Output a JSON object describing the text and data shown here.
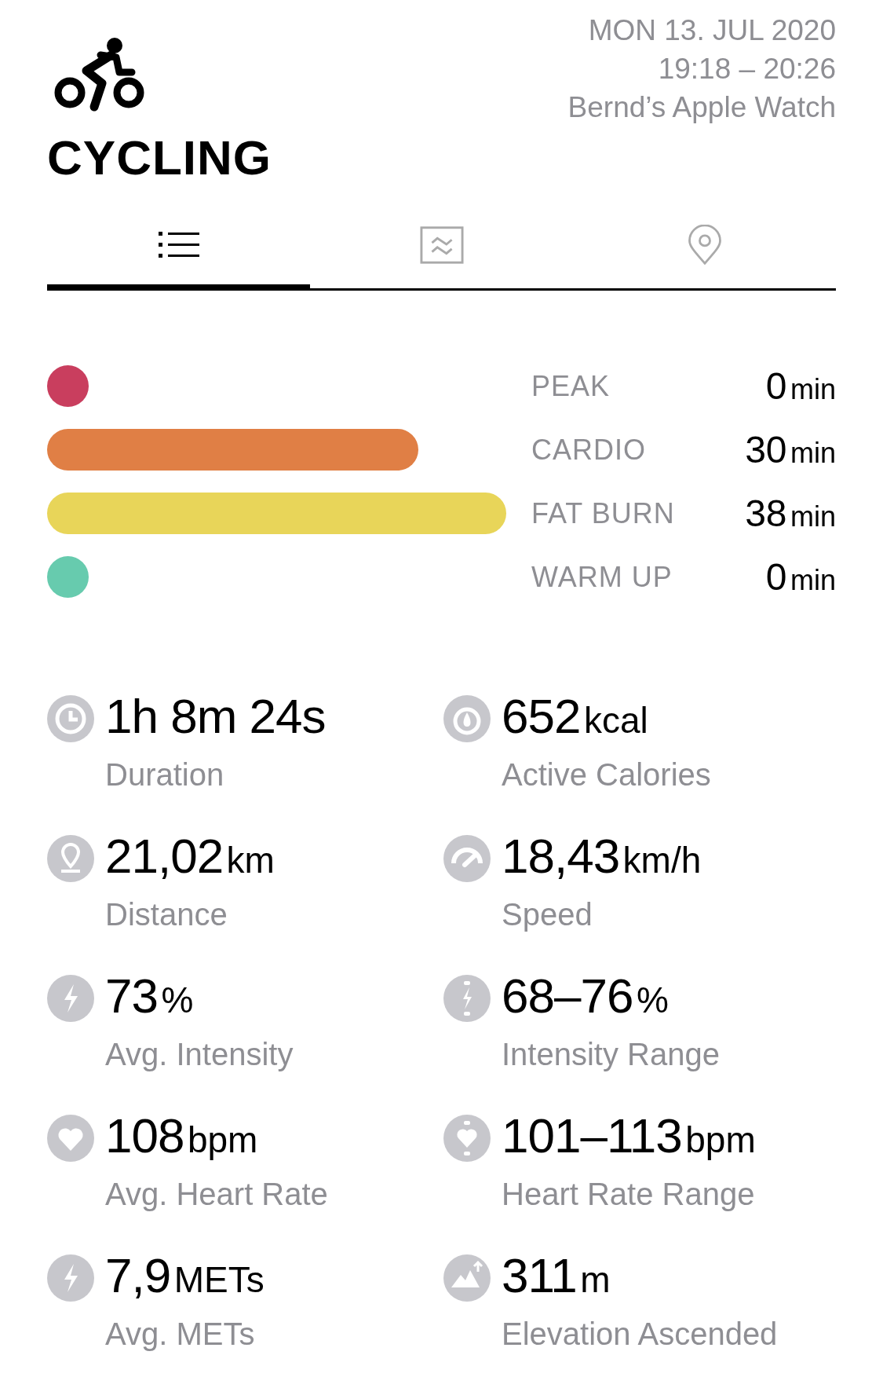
{
  "workout": {
    "title": "CYCLING",
    "date": "MON 13. JUL 2020",
    "time": "19:18 – 20:26",
    "device": "Bernd’s Apple Watch"
  },
  "tabs": [
    {
      "selected": true
    },
    {
      "selected": false
    },
    {
      "selected": false
    }
  ],
  "zones": [
    {
      "name": "PEAK",
      "value": "0",
      "unit": "min",
      "color": "#c93e5e"
    },
    {
      "name": "CARDIO",
      "value": "30",
      "unit": "min",
      "color": "#e07f45"
    },
    {
      "name": "FAT BURN",
      "value": "38",
      "unit": "min",
      "color": "#e8d559"
    },
    {
      "name": "WARM UP",
      "value": "0",
      "unit": "min",
      "color": "#67cbae"
    }
  ],
  "stats": [
    {
      "value": "1h 8m 24s",
      "label": "Duration"
    },
    {
      "value": "652",
      "unit": "kcal",
      "label": "Active Calories"
    },
    {
      "value": "21,02",
      "unit": "km",
      "label": "Distance"
    },
    {
      "value": "18,43",
      "unit": "km/h",
      "label": "Speed"
    },
    {
      "value": "73",
      "unit": "%",
      "label": "Avg. Intensity"
    },
    {
      "value": "68–76",
      "unit": "%",
      "label": "Intensity Range"
    },
    {
      "value": "108",
      "unit": "bpm",
      "label": "Avg. Heart Rate"
    },
    {
      "value": "101–113",
      "unit": "bpm",
      "label": "Heart Rate Range"
    },
    {
      "value": "7,9",
      "unit": "METs",
      "label": "Avg. METs"
    },
    {
      "value": "311",
      "unit": "m",
      "label": "Elevation Ascended"
    }
  ]
}
